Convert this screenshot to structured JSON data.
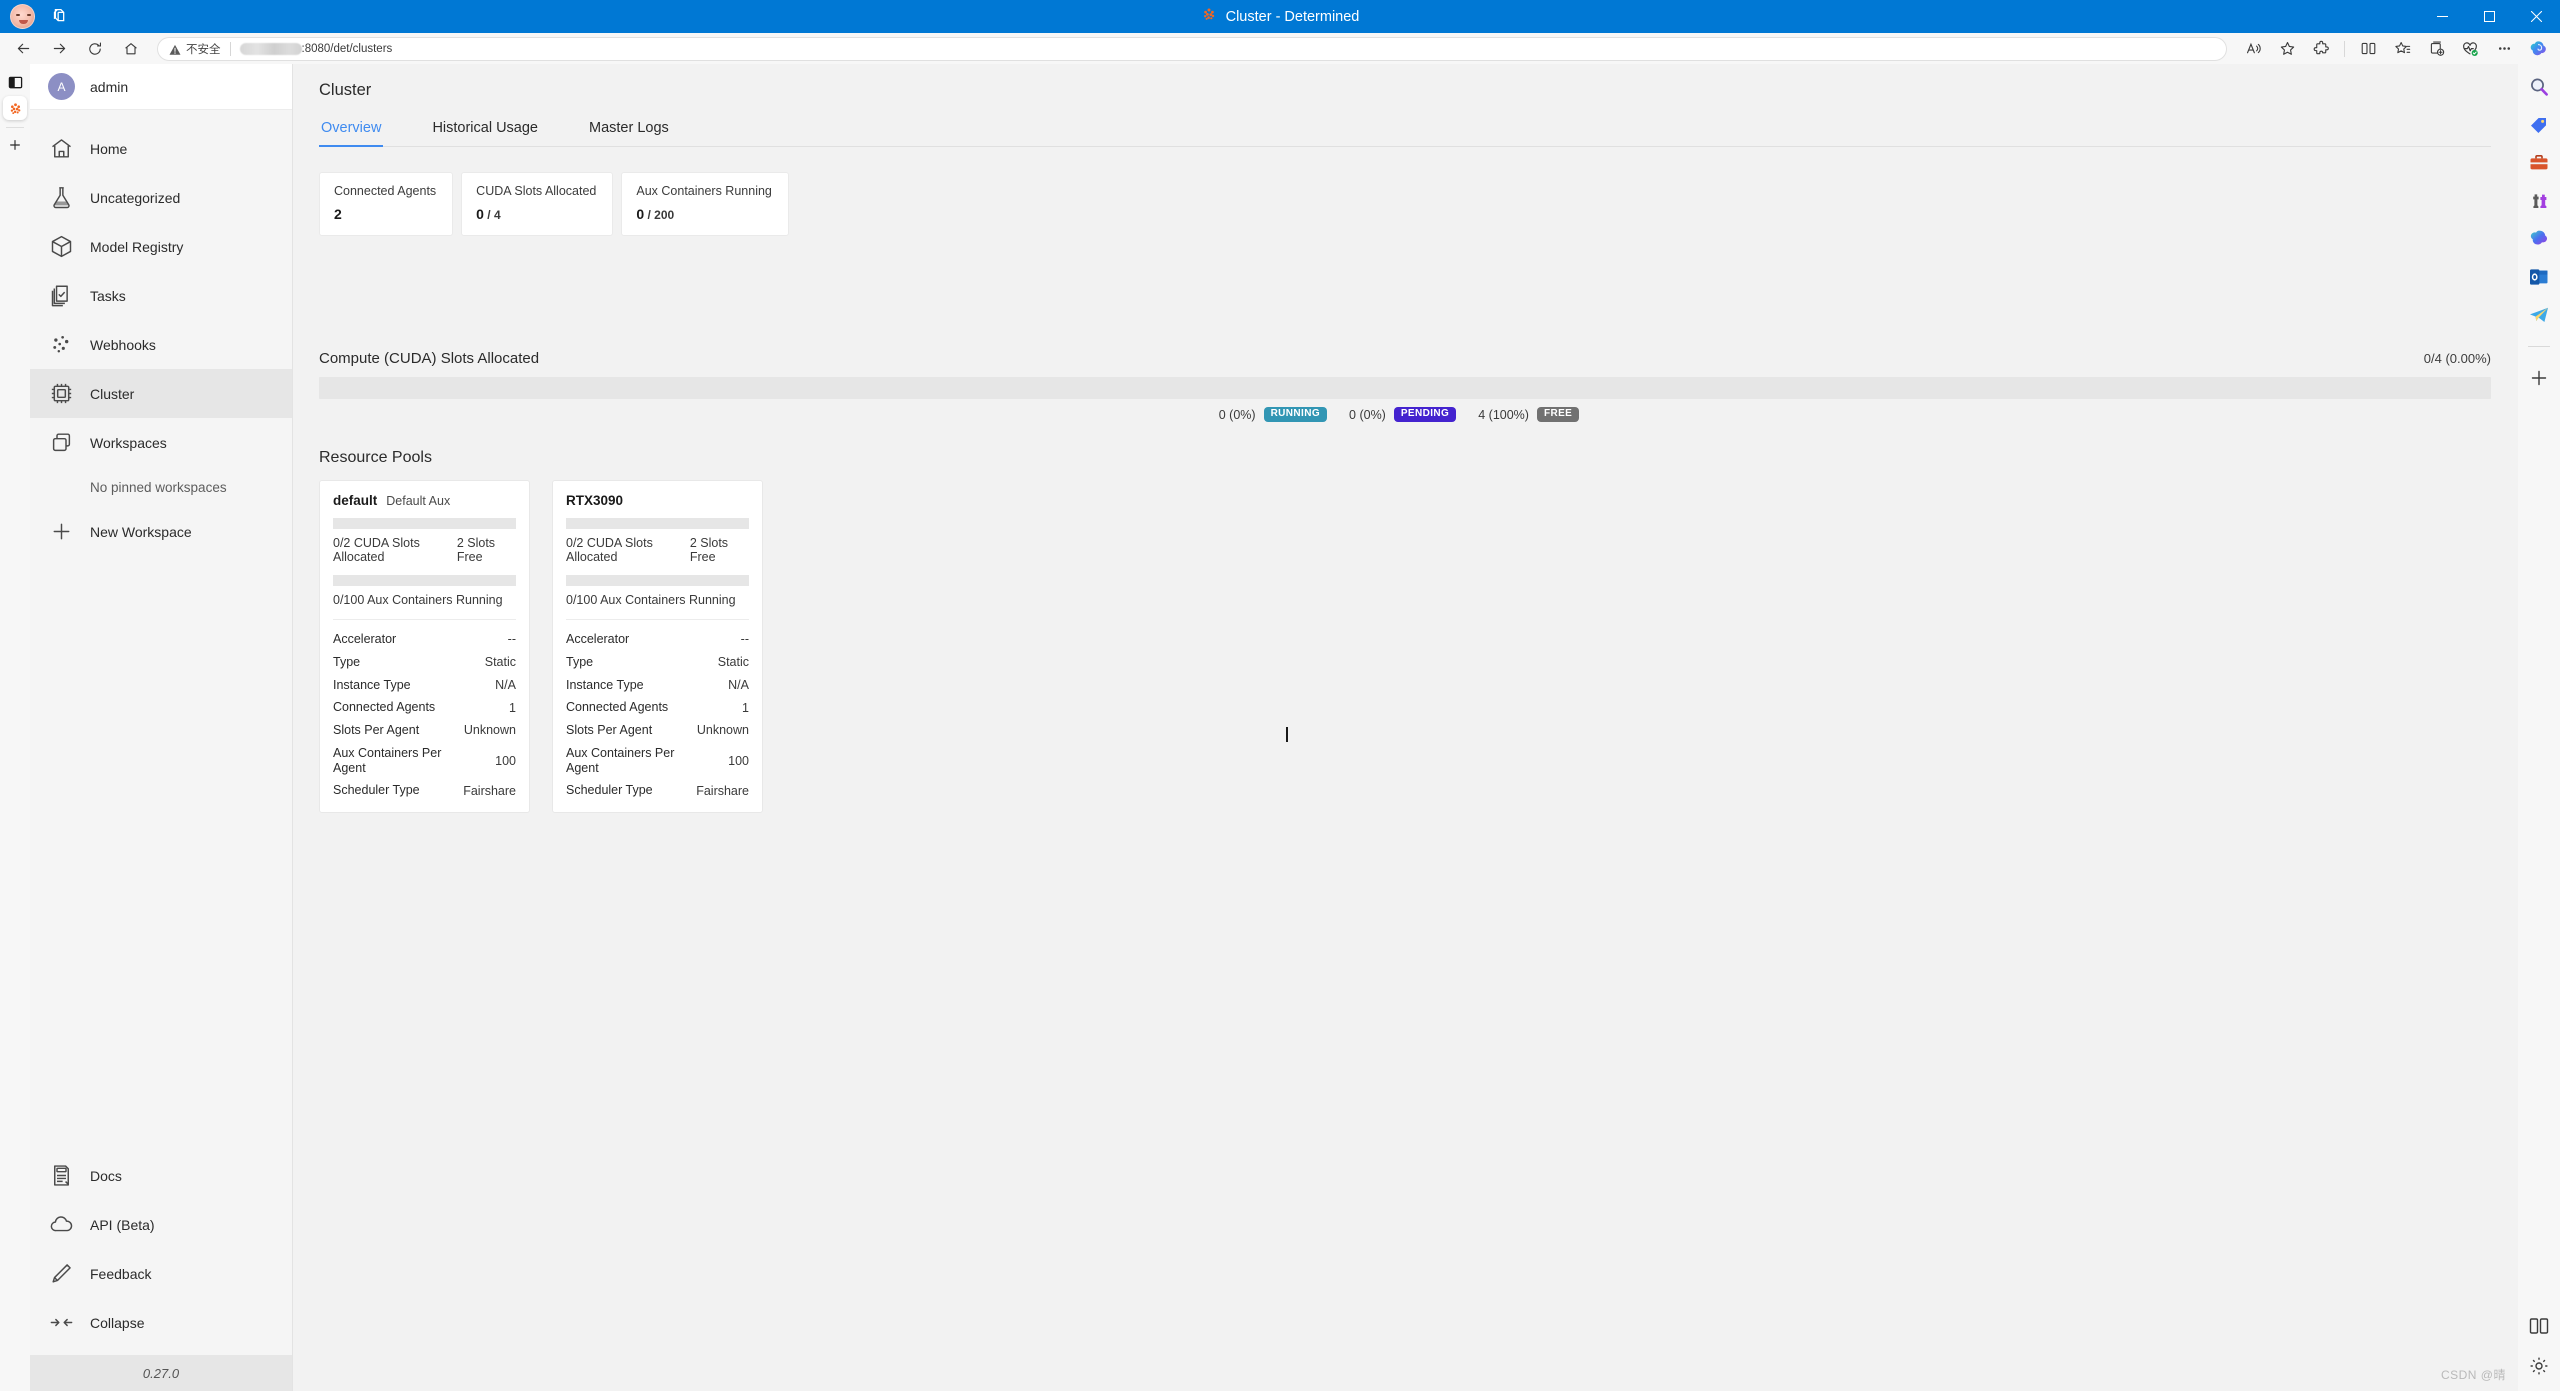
{
  "window": {
    "title": "Cluster - Determined",
    "logo_icon": "determined-brain-icon",
    "minimize_label": "Minimize",
    "maximize_label": "Restore",
    "close_label": "Close"
  },
  "browser": {
    "back_icon": "back-arrow-icon",
    "forward_icon": "forward-arrow-icon",
    "refresh_icon": "refresh-icon",
    "home_icon": "home-icon",
    "security_icon": "warning-triangle-icon",
    "security_text": "不安全",
    "url_redacted": "",
    "url": ":8080/det/clusters",
    "read_aloud_icon": "read-aloud-icon",
    "favorite_icon": "star-outline-icon",
    "extensions_icon": "puzzle-piece-icon",
    "split_screen_icon": "split-screen-icon",
    "favorites_icon": "favorites-list-icon",
    "collections_icon": "collections-add-icon",
    "browser_essentials_icon": "browser-essentials-icon",
    "more_icon": "ellipsis-icon",
    "copilot_icon": "copilot-icon",
    "tabstrip": {
      "panel_toggle_icon": "tab-panel-toggle-icon",
      "active_tab_icon": "determined-brain-icon",
      "new_tab_icon": "plus-icon"
    },
    "edgebar": {
      "items": [
        {
          "icon": "search-icon"
        },
        {
          "icon": "shopping-tag-icon"
        },
        {
          "icon": "tools-briefcase-icon"
        },
        {
          "icon": "games-icon"
        },
        {
          "icon": "microsoft-365-icon"
        },
        {
          "icon": "outlook-icon"
        },
        {
          "icon": "telegram-icon"
        }
      ],
      "add_icon": "plus-icon",
      "split_icon": "split-screen-icon",
      "settings_icon": "gear-icon"
    }
  },
  "sidebar": {
    "user": {
      "initial": "A",
      "name": "admin",
      "avatar_color": "#8c8fc4"
    },
    "items": [
      {
        "label": "Home",
        "icon": "home-icon",
        "active": false
      },
      {
        "label": "Uncategorized",
        "icon": "flask-icon",
        "active": false
      },
      {
        "label": "Model Registry",
        "icon": "cube-icon",
        "active": false
      },
      {
        "label": "Tasks",
        "icon": "tasks-icon",
        "active": false
      },
      {
        "label": "Webhooks",
        "icon": "webhooks-icon",
        "active": false
      },
      {
        "label": "Cluster",
        "icon": "cluster-chip-icon",
        "active": true
      },
      {
        "label": "Workspaces",
        "icon": "workspaces-icon",
        "active": false
      }
    ],
    "empty_workspaces": "No pinned workspaces",
    "new_workspace": {
      "label": "New Workspace",
      "icon": "plus-icon"
    },
    "bottom_items": [
      {
        "label": "Docs",
        "icon": "docs-icon"
      },
      {
        "label": "API (Beta)",
        "icon": "cloud-icon"
      },
      {
        "label": "Feedback",
        "icon": "pencil-icon"
      },
      {
        "label": "Collapse",
        "icon": "collapse-icon"
      }
    ],
    "version": "0.27.0"
  },
  "main": {
    "page_title": "Cluster",
    "tabs": [
      {
        "label": "Overview",
        "active": true
      },
      {
        "label": "Historical Usage",
        "active": false
      },
      {
        "label": "Master Logs",
        "active": false
      }
    ],
    "accent_color": "#3f8bf0",
    "stats": [
      {
        "label": "Connected Agents",
        "value": "2",
        "denominator": ""
      },
      {
        "label": "CUDA Slots Allocated",
        "value": "0",
        "denominator": " / 4"
      },
      {
        "label": "Aux Containers Running",
        "value": "0",
        "denominator": " / 200"
      }
    ],
    "compute": {
      "title": "Compute (CUDA) Slots Allocated",
      "summary": "0/4 (0.00%)",
      "bar_background": "#e6e6e6",
      "legend": [
        {
          "count": "0 (0%)",
          "label": "RUNNING",
          "color": "#3296b4"
        },
        {
          "count": "0 (0%)",
          "label": "PENDING",
          "color": "#4423cf"
        },
        {
          "count": "4 (100%)",
          "label": "FREE",
          "color": "#717171"
        }
      ]
    },
    "resource_pools": {
      "title": "Resource Pools",
      "pools": [
        {
          "name": "default",
          "tag": "Default Aux",
          "slots_text": "0/2 CUDA Slots Allocated",
          "slots_free": "2 Slots Free",
          "aux_text": "0/100 Aux Containers Running",
          "rows": [
            {
              "key": "Accelerator",
              "value": "--"
            },
            {
              "key": "Type",
              "value": "Static"
            },
            {
              "key": "Instance Type",
              "value": "N/A"
            },
            {
              "key": "Connected Agents",
              "value": "1"
            },
            {
              "key": "Slots Per Agent",
              "value": "Unknown"
            },
            {
              "key": "Aux Containers Per Agent",
              "value": "100"
            },
            {
              "key": "Scheduler Type",
              "value": "Fairshare"
            }
          ]
        },
        {
          "name": "RTX3090",
          "tag": "",
          "slots_text": "0/2 CUDA Slots Allocated",
          "slots_free": "2 Slots Free",
          "aux_text": "0/100 Aux Containers Running",
          "rows": [
            {
              "key": "Accelerator",
              "value": "--"
            },
            {
              "key": "Type",
              "value": "Static"
            },
            {
              "key": "Instance Type",
              "value": "N/A"
            },
            {
              "key": "Connected Agents",
              "value": "1"
            },
            {
              "key": "Slots Per Agent",
              "value": "Unknown"
            },
            {
              "key": "Aux Containers Per Agent",
              "value": "100"
            },
            {
              "key": "Scheduler Type",
              "value": "Fairshare"
            }
          ]
        }
      ]
    }
  },
  "watermark": "CSDN @晴"
}
